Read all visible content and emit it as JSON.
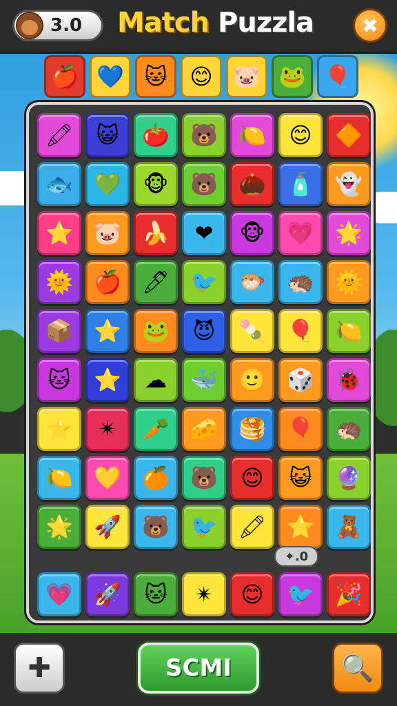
{
  "header": {
    "score": "3.0",
    "title_word1": "Match",
    "title_word2": "Puzzla",
    "close_glyph": "✖"
  },
  "targets": [
    {
      "icon": "apple-icon",
      "glyph": "🍎",
      "color": "#e23b2e"
    },
    {
      "icon": "heart-icon",
      "glyph": "💙",
      "color": "#ffd53a"
    },
    {
      "icon": "cat-face-icon",
      "glyph": "🐱",
      "color": "#ff8a1e"
    },
    {
      "icon": "blob-face-icon",
      "glyph": "😊",
      "color": "#ffd53a"
    },
    {
      "icon": "pink-blob-icon",
      "glyph": "🐷",
      "color": "#ffd53a"
    },
    {
      "icon": "frog-face-icon",
      "glyph": "🐸",
      "color": "#4cae3a"
    },
    {
      "icon": "balloon-icon",
      "glyph": "🎈",
      "color": "#3aa6ee"
    }
  ],
  "grid": [
    [
      {
        "icon": "crayon-icon",
        "glyph": "🖍",
        "color": "#e34ad9"
      },
      {
        "icon": "cat-face-icon",
        "glyph": "😺",
        "color": "#3b3fd8"
      },
      {
        "icon": "apple-icon",
        "glyph": "🍅",
        "color": "#2fd08a"
      },
      {
        "icon": "face-icon",
        "glyph": "🐻",
        "color": "#8ad12b"
      },
      {
        "icon": "lemon-icon",
        "glyph": "🍋",
        "color": "#e34ad9"
      },
      {
        "icon": "blob-face-icon",
        "glyph": "😊",
        "color": "#ffe53a"
      },
      {
        "icon": "gem-icon",
        "glyph": "🔶",
        "color": "#e82d2d"
      }
    ],
    [
      {
        "icon": "fish-icon",
        "glyph": "🐟",
        "color": "#3aaeea"
      },
      {
        "icon": "heart-icon",
        "glyph": "💚",
        "color": "#2bb6e8"
      },
      {
        "icon": "monkey-icon",
        "glyph": "🐵",
        "color": "#9ad82b"
      },
      {
        "icon": "bear-icon",
        "glyph": "🐻",
        "color": "#6ccf2f"
      },
      {
        "icon": "acorn-icon",
        "glyph": "🌰",
        "color": "#e82d2d"
      },
      {
        "icon": "bottle-icon",
        "glyph": "🧴",
        "color": "#3a6fe8"
      },
      {
        "icon": "ghost-face-icon",
        "glyph": "👻",
        "color": "#ff9a1e"
      }
    ],
    [
      {
        "icon": "star-icon",
        "glyph": "⭐",
        "color": "#ff3e8a"
      },
      {
        "icon": "pig-icon",
        "glyph": "🐷",
        "color": "#ff9a1e"
      },
      {
        "icon": "banana-icon",
        "glyph": "🍌",
        "color": "#e82d2d"
      },
      {
        "icon": "heart-icon",
        "glyph": "❤",
        "color": "#3ab8ee"
      },
      {
        "icon": "monkey-icon",
        "glyph": "🐵",
        "color": "#c83ae0"
      },
      {
        "icon": "heart-icon",
        "glyph": "💗",
        "color": "#ff4ab0"
      },
      {
        "icon": "star-icon",
        "glyph": "🌟",
        "color": "#e34ad9"
      }
    ],
    [
      {
        "icon": "sun-face-icon",
        "glyph": "🌞",
        "color": "#9a3ae0"
      },
      {
        "icon": "apple-icon",
        "glyph": "🍎",
        "color": "#ff8a1e"
      },
      {
        "icon": "crayon-icon",
        "glyph": "🖊",
        "color": "#4cae3a"
      },
      {
        "icon": "bird-icon",
        "glyph": "🐦",
        "color": "#8ad12b"
      },
      {
        "icon": "fish-icon",
        "glyph": "🐡",
        "color": "#3ab8ee"
      },
      {
        "icon": "urchin-icon",
        "glyph": "🦔",
        "color": "#3ab8ee"
      },
      {
        "icon": "sun-icon",
        "glyph": "🌞",
        "color": "#ff9a1e"
      }
    ],
    [
      {
        "icon": "box-icon",
        "glyph": "📦",
        "color": "#9a3ae0"
      },
      {
        "icon": "star-icon",
        "glyph": "⭐",
        "color": "#2f7fe8"
      },
      {
        "icon": "frog-face-icon",
        "glyph": "🐸",
        "color": "#ff8a1e"
      },
      {
        "icon": "devil-face-icon",
        "glyph": "😈",
        "color": "#2f5fe8"
      },
      {
        "icon": "popsicle-icon",
        "glyph": "🍡",
        "color": "#ffe53a"
      },
      {
        "icon": "balloon-icon",
        "glyph": "🎈",
        "color": "#ffe53a"
      },
      {
        "icon": "lemon-icon",
        "glyph": "🍋",
        "color": "#8ad12b"
      }
    ],
    [
      {
        "icon": "cat-face-icon",
        "glyph": "🐱",
        "color": "#c83ae0"
      },
      {
        "icon": "star-icon",
        "glyph": "⭐",
        "color": "#2f3fd8"
      },
      {
        "icon": "cloud-face-icon",
        "glyph": "☁",
        "color": "#8ad12b"
      },
      {
        "icon": "fish-icon",
        "glyph": "🐳",
        "color": "#6ccf2f"
      },
      {
        "icon": "smile-face-icon",
        "glyph": "🙂",
        "color": "#ff9a1e"
      },
      {
        "icon": "dice-icon",
        "glyph": "🎲",
        "color": "#ff9a1e"
      },
      {
        "icon": "bug-icon",
        "glyph": "🐞",
        "color": "#e34ad9"
      }
    ],
    [
      {
        "icon": "star-icon",
        "glyph": "⭐",
        "color": "#ffe53a"
      },
      {
        "icon": "star-icon",
        "glyph": "✴",
        "color": "#e82d5a"
      },
      {
        "icon": "carrot-icon",
        "glyph": "🥕",
        "color": "#2fd08a"
      },
      {
        "icon": "cheese-icon",
        "glyph": "🧀",
        "color": "#ff9a1e"
      },
      {
        "icon": "stack-icon",
        "glyph": "🥞",
        "color": "#2f8fe8"
      },
      {
        "icon": "balloon-icon",
        "glyph": "🎈",
        "color": "#ff8a1e"
      },
      {
        "icon": "hedgehog-icon",
        "glyph": "🦔",
        "color": "#4cae3a"
      }
    ],
    [
      {
        "icon": "lemon-icon",
        "glyph": "🍋",
        "color": "#3ab8ee"
      },
      {
        "icon": "heart-icon",
        "glyph": "💛",
        "color": "#ff4ab0"
      },
      {
        "icon": "orange-icon",
        "glyph": "🍊",
        "color": "#3ab8ee"
      },
      {
        "icon": "bear-icon",
        "glyph": "🐻",
        "color": "#2fd08a"
      },
      {
        "icon": "face-icon",
        "glyph": "😊",
        "color": "#e82d2d"
      },
      {
        "icon": "ghost-face-icon",
        "glyph": "😺",
        "color": "#ff9a1e"
      },
      {
        "icon": "ball-icon",
        "glyph": "🔮",
        "color": "#8ad12b"
      }
    ],
    [
      {
        "icon": "star-icon",
        "glyph": "🌟",
        "color": "#4cae3a"
      },
      {
        "icon": "rocket-icon",
        "glyph": "🚀",
        "color": "#ffe53a"
      },
      {
        "icon": "bear-icon",
        "glyph": "🐻",
        "color": "#3ab8ee"
      },
      {
        "icon": "bird-icon",
        "glyph": "🐦",
        "color": "#8ad12b"
      },
      {
        "icon": "crayon-icon",
        "glyph": "🖍",
        "color": "#ffe53a"
      },
      {
        "icon": "star-icon",
        "glyph": "⭐",
        "color": "#ff8a1e"
      },
      {
        "icon": "figure-icon",
        "glyph": "🧸",
        "color": "#3ab8ee"
      }
    ]
  ],
  "bonus_badge": "✦.0",
  "bottom_row": [
    {
      "icon": "heart-icon",
      "glyph": "💗",
      "color": "#3ab8ee"
    },
    {
      "icon": "rocket-icon",
      "glyph": "🚀",
      "color": "#7a3ae0"
    },
    {
      "icon": "cat-face-icon",
      "glyph": "🐱",
      "color": "#4cae3a"
    },
    {
      "icon": "star-icon",
      "glyph": "✴",
      "color": "#ffe53a"
    },
    {
      "icon": "smile-face-icon",
      "glyph": "😊",
      "color": "#e82d2d"
    },
    {
      "icon": "bird-icon",
      "glyph": "🐦",
      "color": "#c83ae0"
    },
    {
      "icon": "party-hat-icon",
      "glyph": "🎉",
      "color": "#e82d2d"
    }
  ],
  "footer": {
    "left_glyph": "✚",
    "main_label": "SCMI",
    "right_glyph": "🔍"
  }
}
